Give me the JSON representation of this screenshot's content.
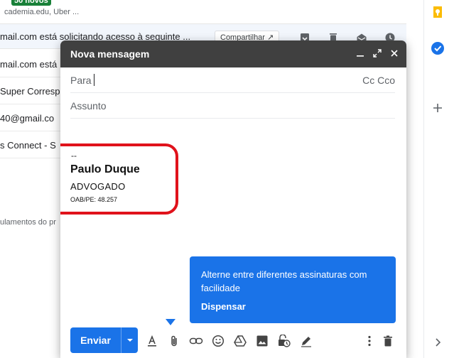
{
  "inbox": {
    "top_snippet": "cademia.edu, Uber ...",
    "new_badge": "50 novos",
    "rows": [
      {
        "text": "mail.com está solicitando acesso à seguinte ..."
      },
      {
        "text": "mail.com está"
      },
      {
        "text": "Super Corresp"
      },
      {
        "text": " 40@gmail.co"
      },
      {
        "text": "s Connect - S"
      }
    ],
    "share_label": "Compartilhar ↗",
    "footer_text": "ulamentos do pr"
  },
  "compose": {
    "title": "Nova mensagem",
    "to_label": "Para",
    "cc_bcc": "Cc Cco",
    "subject_placeholder": "Assunto",
    "signature": {
      "dash": "--",
      "name": "Paulo Duque",
      "title": "ADVOGADO",
      "oab": "OAB/PE: 48.257"
    },
    "tip": {
      "text": "Alterne entre diferentes assinaturas com facilidade",
      "dismiss": "Dispensar"
    },
    "send_label": "Enviar"
  },
  "icons": {
    "minimize": "minimize-icon",
    "expand": "expand-icon",
    "close": "close-icon",
    "format": "format-text-icon",
    "attach": "attach-icon",
    "link": "link-icon",
    "emoji": "emoji-icon",
    "drive": "drive-icon",
    "photo": "photo-icon",
    "confidential": "confidential-icon",
    "signature": "signature-pen-icon",
    "more": "more-vert-icon",
    "trash": "trash-icon"
  },
  "colors": {
    "accent": "#1a73e8",
    "header": "#404040",
    "highlight": "#e0121b",
    "badge": "#188038"
  }
}
